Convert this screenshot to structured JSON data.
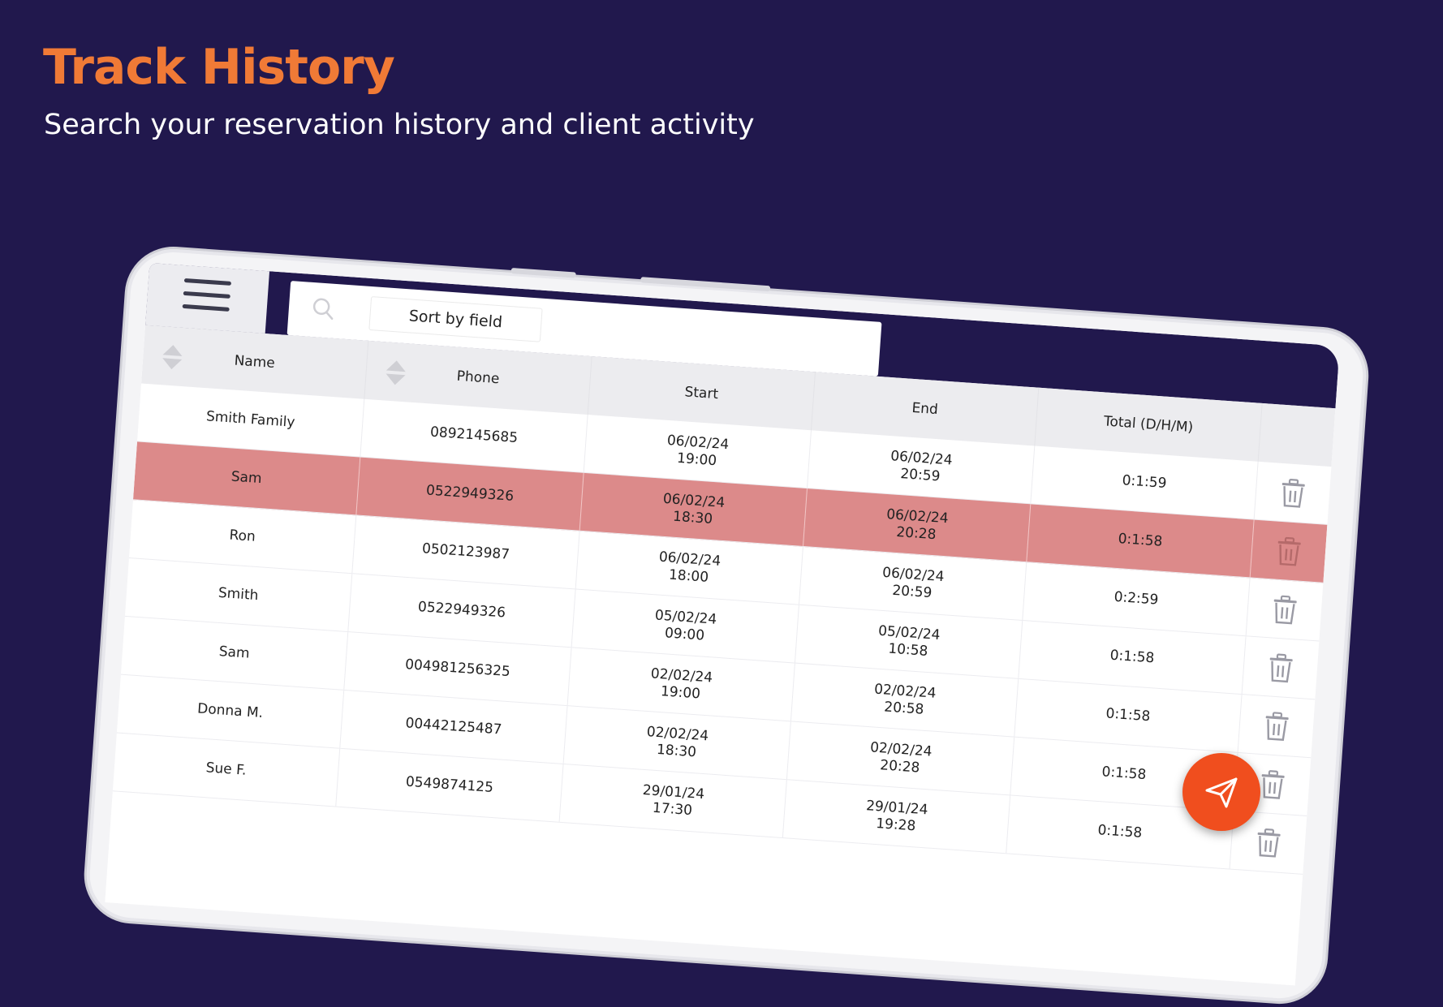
{
  "hero": {
    "title": "Track History",
    "subtitle": "Search your reservation history and client activity"
  },
  "colors": {
    "background": "#21184d",
    "title": "#f07a36",
    "selected_row": "#dc8a8a",
    "fab": "#f04e1e"
  },
  "toolbar": {
    "menu_icon": "hamburger-menu-icon",
    "search_icon": "search-icon",
    "sort_label": "Sort by field"
  },
  "table": {
    "headers": {
      "name": "Name",
      "phone": "Phone",
      "start": "Start",
      "end": "End",
      "total": "Total (D/H/M)"
    },
    "selected_row_index": 1,
    "rows": [
      {
        "name": "Smith Family",
        "phone": "0892145685",
        "start_date": "06/02/24",
        "start_time": "19:00",
        "end_date": "06/02/24",
        "end_time": "20:59",
        "total": "0:1:59"
      },
      {
        "name": "Sam",
        "phone": "0522949326",
        "start_date": "06/02/24",
        "start_time": "18:30",
        "end_date": "06/02/24",
        "end_time": "20:28",
        "total": "0:1:58"
      },
      {
        "name": "Ron",
        "phone": "0502123987",
        "start_date": "06/02/24",
        "start_time": "18:00",
        "end_date": "06/02/24",
        "end_time": "20:59",
        "total": "0:2:59"
      },
      {
        "name": "Smith",
        "phone": "0522949326",
        "start_date": "05/02/24",
        "start_time": "09:00",
        "end_date": "05/02/24",
        "end_time": "10:58",
        "total": "0:1:58"
      },
      {
        "name": "Sam",
        "phone": "004981256325",
        "start_date": "02/02/24",
        "start_time": "19:00",
        "end_date": "02/02/24",
        "end_time": "20:58",
        "total": "0:1:58"
      },
      {
        "name": "Donna M.",
        "phone": "00442125487",
        "start_date": "02/02/24",
        "start_time": "18:30",
        "end_date": "02/02/24",
        "end_time": "20:28",
        "total": "0:1:58"
      },
      {
        "name": "Sue F.",
        "phone": "0549874125",
        "start_date": "29/01/24",
        "start_time": "17:30",
        "end_date": "29/01/24",
        "end_time": "19:28",
        "total": "0:1:58"
      }
    ],
    "row_action_icon": "trash-icon"
  },
  "fab": {
    "icon": "send-icon"
  }
}
